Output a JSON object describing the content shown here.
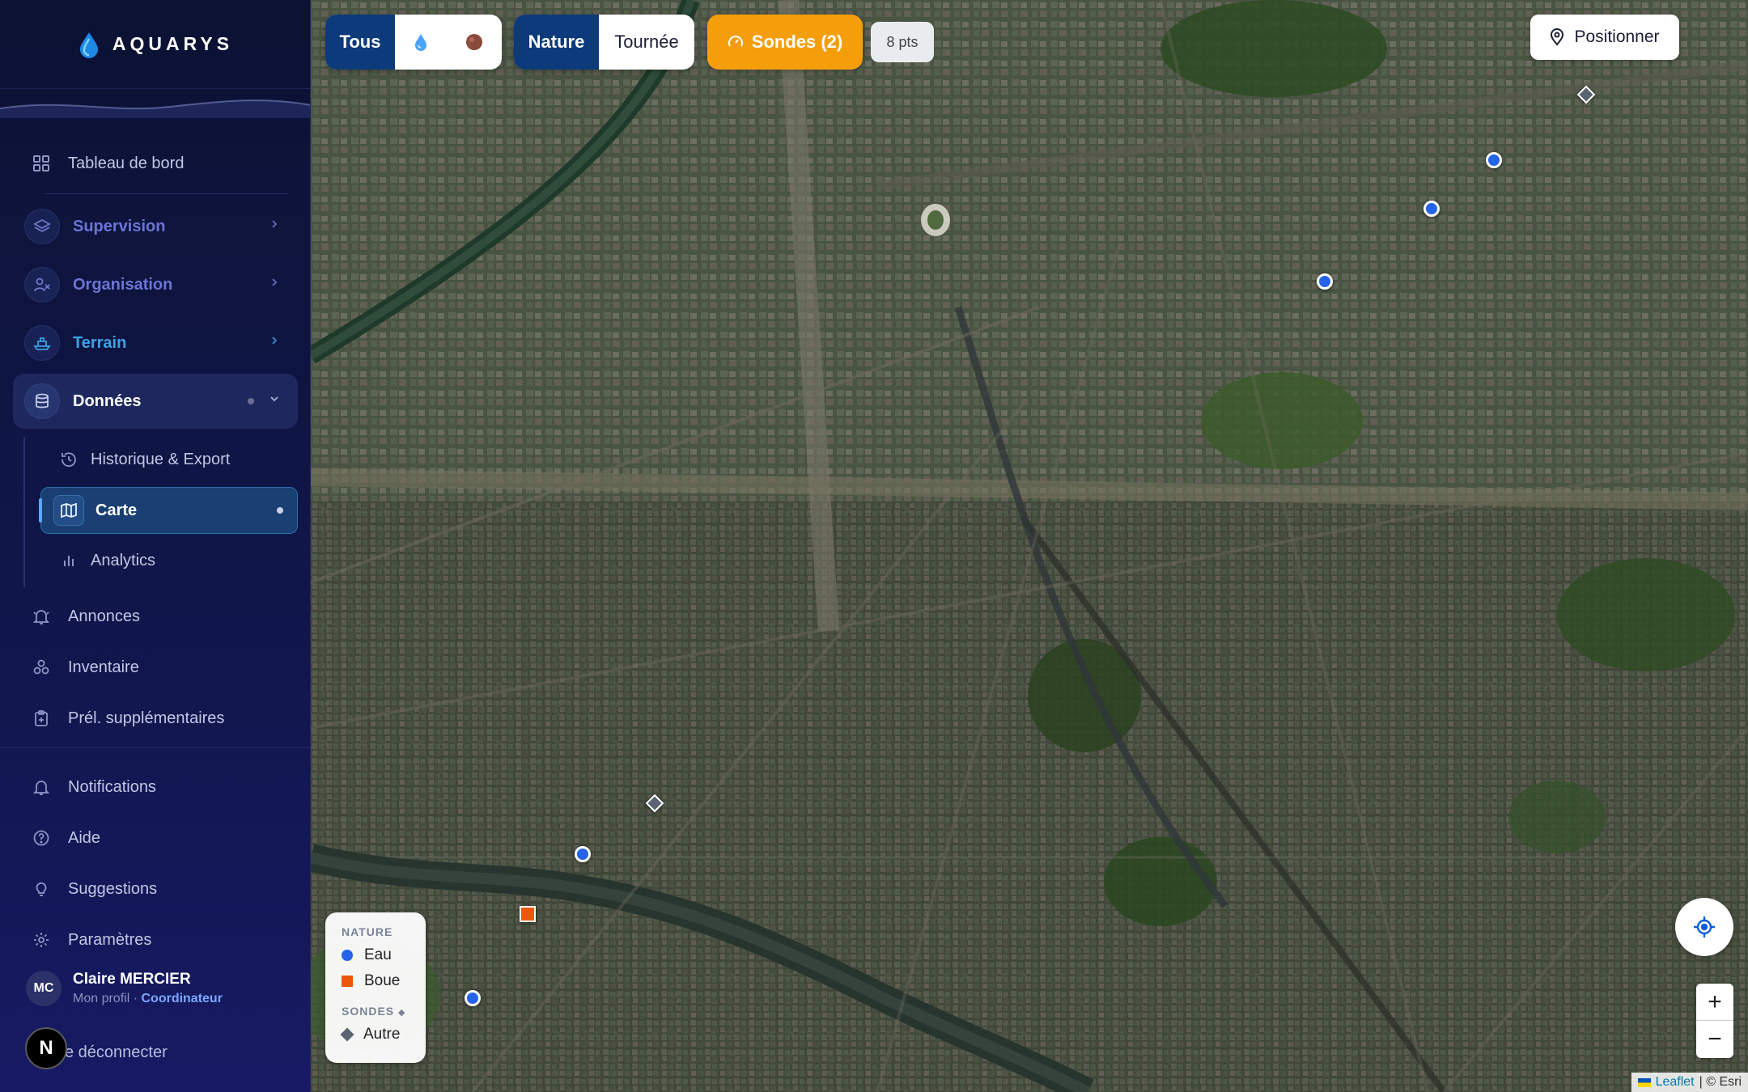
{
  "app": {
    "brand": "AQUARYS"
  },
  "sidebar": {
    "dashboard": "Tableau de bord",
    "groups": {
      "supervision": "Supervision",
      "organisation": "Organisation",
      "terrain": "Terrain",
      "donnees": "Données"
    },
    "donnees_items": {
      "historique": "Historique & Export",
      "carte": "Carte",
      "analytics": "Analytics"
    },
    "items": {
      "annonces": "Annonces",
      "inventaire": "Inventaire",
      "prel": "Prél. supplémentaires",
      "notifications": "Notifications",
      "aide": "Aide",
      "suggestions": "Suggestions",
      "parametres": "Paramètres"
    },
    "user": {
      "initials": "MC",
      "name": "Claire MERCIER",
      "profile_link": "Mon profil",
      "separator": "·",
      "role": "Coordinateur"
    },
    "logout": "e déconnecter",
    "n_badge": "N"
  },
  "map": {
    "filter_all": "Tous",
    "mode_nature": "Nature",
    "mode_tournee": "Tournée",
    "sondes": "Sondes (2)",
    "points": "8 pts",
    "positionner": "Positionner",
    "legend": {
      "nature_title": "NATURE",
      "eau": "Eau",
      "boue": "Boue",
      "sondes_title": "SONDES",
      "sondes_mark": "◆",
      "autre": "Autre"
    },
    "zoom_in": "+",
    "zoom_out": "−",
    "attribution_leaflet": "Leaflet",
    "attribution_rest": "| © Esri"
  },
  "colors": {
    "eau": "#2563eb",
    "boue": "#ea580c",
    "sonde": "#5b6473",
    "accent": "#f59e0b",
    "active": "#0c3a7a"
  }
}
